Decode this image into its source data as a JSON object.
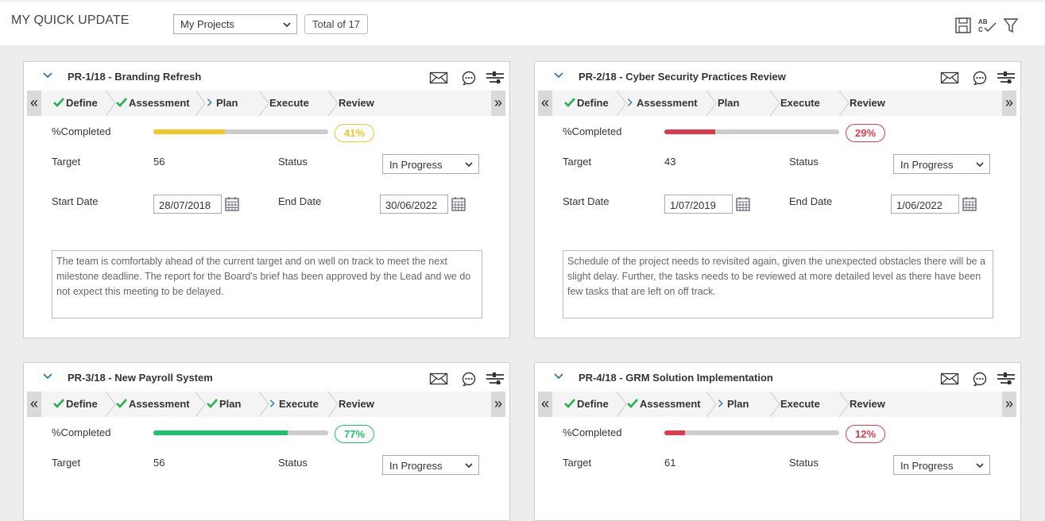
{
  "header": {
    "title": "MY QUICK UPDATE",
    "filter_value": "My Projects",
    "total_label": "Total of 17",
    "icons": [
      "save-icon",
      "spellcheck-icon",
      "filter-icon"
    ]
  },
  "labels": {
    "completed": "%Completed",
    "target": "Target",
    "status": "Status",
    "start_date": "Start Date",
    "end_date": "End Date",
    "prev": "«",
    "next": "»"
  },
  "steps": [
    "Define",
    "Assessment",
    "Plan",
    "Execute",
    "Review"
  ],
  "colors": {
    "done": "#21b24f",
    "current": "#2f74b5",
    "yellow": "#f5c425",
    "red": "#dc3b4e",
    "green": "#1fc06c"
  },
  "cards": [
    {
      "title": "PR-1/18 - Branding Refresh",
      "steps_state": [
        "done",
        "done",
        "current",
        "todo",
        "todo"
      ],
      "completed": 41,
      "completed_label": "41%",
      "color": "#f5c425",
      "target": "56",
      "status": "In Progress",
      "start_date": "28/07/2018",
      "end_date": "30/06/2022",
      "notes": "The team is comfortably ahead of the current target and on well on track to meet the next milestone deadline. The report for the Board's brief has been approved by the Lead and we do not expect this meeting to be delayed."
    },
    {
      "title": "PR-2/18 - Cyber Security Practices Review",
      "steps_state": [
        "done",
        "current",
        "todo",
        "todo",
        "todo"
      ],
      "completed": 29,
      "completed_label": "29%",
      "color": "#dc3b4e",
      "target": "43",
      "status": "In Progress",
      "start_date": "1/07/2019",
      "end_date": "1/06/2022",
      "notes": "Schedule of the project needs to revisited again, given the unexpected obstacles there will be a slight delay. Further, the tasks needs to be reviewed at more detailed level as there have been few tasks that are left on off track."
    },
    {
      "title": "PR-3/18 - New Payroll System",
      "steps_state": [
        "done",
        "done",
        "done",
        "current",
        "todo"
      ],
      "completed": 77,
      "completed_label": "77%",
      "color": "#1fc06c",
      "target": "56",
      "status": "In Progress"
    },
    {
      "title": "PR-4/18 - GRM Solution Implementation",
      "steps_state": [
        "done",
        "done",
        "current",
        "todo",
        "todo"
      ],
      "completed": 12,
      "completed_label": "12%",
      "color": "#dc3b4e",
      "target": "61",
      "status": "In Progress"
    }
  ]
}
